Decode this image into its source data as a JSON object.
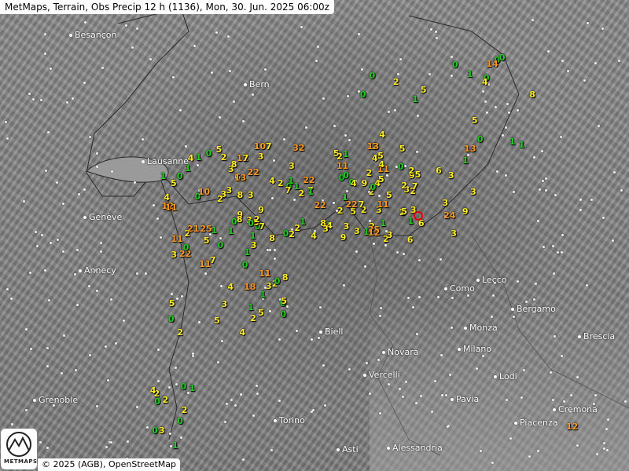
{
  "header": {
    "title": "MetMaps, Terrain, Obs Precip 12 h (1136), Mon, 30. Jun. 2025 06:00z"
  },
  "footer": {
    "copyright": "© 2025 (AGB), OpenStreetMap",
    "logo_text": "METMAPS"
  },
  "colors": {
    "zero": "#22cc22",
    "low": "#ffee22",
    "mid": "#ff9922",
    "marker": "#e00000"
  },
  "cities": [
    {
      "name": "Besançon"
    },
    {
      "name": "Bern"
    },
    {
      "name": "Lausanne"
    },
    {
      "name": "Genève"
    },
    {
      "name": "Annecy"
    },
    {
      "name": "Grenoble"
    },
    {
      "name": "Torino"
    },
    {
      "name": "Asti"
    },
    {
      "name": "Alessandria"
    },
    {
      "name": "Vercelli"
    },
    {
      "name": "Novara"
    },
    {
      "name": "Biell"
    },
    {
      "name": "Milano"
    },
    {
      "name": "Monza"
    },
    {
      "name": "Como"
    },
    {
      "name": "Lecco"
    },
    {
      "name": "Bergamo"
    },
    {
      "name": "Brescia"
    },
    {
      "name": "Lodi"
    },
    {
      "name": "Pavia"
    },
    {
      "name": "Piacenza"
    },
    {
      "name": "Cremona"
    }
  ],
  "observations": [
    "1",
    "1",
    "5",
    "2",
    "0",
    "0",
    "0",
    "0",
    "4",
    "1",
    "0",
    "4",
    "2",
    "1",
    "5",
    "0",
    "0",
    "1",
    "8",
    "14",
    "2",
    "5",
    "1",
    "5",
    "1",
    "4",
    "11",
    "2",
    "2",
    "32",
    "11",
    "13",
    "22",
    "3",
    "2",
    "4",
    "5",
    "4",
    "2",
    "2",
    "4",
    "3",
    "3",
    "12",
    "9",
    "3",
    "3",
    "3",
    "2",
    "2",
    "2",
    "2",
    "1",
    "1",
    "0",
    "0",
    "0",
    "1",
    "1",
    "6",
    "3",
    "10",
    "8",
    "2",
    "2",
    "1",
    "4",
    "11",
    "0",
    "9",
    "4",
    "6",
    "0",
    "9",
    "8",
    "9",
    "7",
    "25",
    "7",
    "0",
    "4",
    "1",
    "2",
    "5",
    "3",
    "3",
    "21",
    "8",
    "3",
    "9",
    "9",
    "5",
    "3",
    "5",
    "3",
    "7",
    "5",
    "10",
    "22",
    "11",
    "0",
    "1",
    "0",
    "3",
    "4",
    "6",
    "5",
    "0",
    "13",
    "1",
    "1",
    "1",
    "2",
    "3",
    "25",
    "2",
    "22",
    "5",
    "24",
    "11",
    "0",
    "3",
    "3",
    "2",
    "1",
    "2",
    "7",
    "5",
    "4",
    "6",
    "0",
    "0",
    "13",
    "1",
    "0",
    "3",
    "5",
    "8",
    "22",
    "2",
    "7",
    "7",
    "3",
    "1",
    "2",
    "11",
    "1",
    "8",
    "12",
    "7",
    "0",
    "3",
    "4",
    "1",
    "11",
    "3",
    "3",
    "5",
    "2",
    "1",
    "0",
    "2",
    "5",
    "1",
    "11",
    "18",
    "2",
    "5",
    "22",
    "8",
    "0",
    "0",
    "4",
    "5",
    "7",
    "3",
    "0",
    "5",
    "0",
    "0",
    "0",
    "0",
    "2",
    "2",
    "0",
    "1",
    "1",
    "0",
    "2",
    "4",
    "3",
    "12"
  ]
}
